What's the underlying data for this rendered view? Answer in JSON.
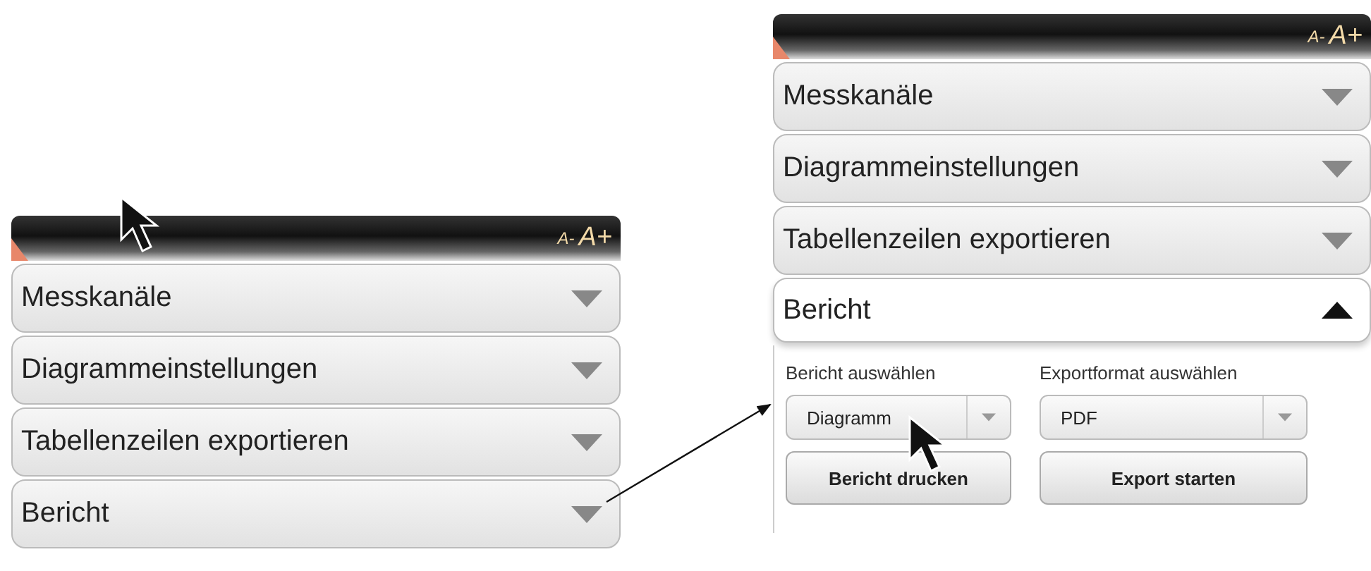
{
  "panels": [
    {
      "font_controls": [
        "A-",
        "A+"
      ],
      "sections": [
        {
          "title": "Messkanäle",
          "expanded": false
        },
        {
          "title": "Diagrammeinstellungen",
          "expanded": false
        },
        {
          "title": "Tabellenzeilen exportieren",
          "expanded": false
        },
        {
          "title": "Bericht",
          "expanded": false
        }
      ]
    },
    {
      "font_controls": [
        "A-",
        "A+"
      ],
      "sections": [
        {
          "title": "Messkanäle",
          "expanded": false
        },
        {
          "title": "Diagrammeinstellungen",
          "expanded": false
        },
        {
          "title": "Tabellenzeilen exportieren",
          "expanded": false
        },
        {
          "title": "Bericht",
          "expanded": true,
          "content": {
            "fields": [
              {
                "label": "Bericht auswählen",
                "value": "Diagramm"
              },
              {
                "label": "Exportformat auswählen",
                "value": "PDF"
              }
            ],
            "buttons": [
              "Bericht drucken",
              "Export starten"
            ]
          }
        }
      ]
    }
  ]
}
